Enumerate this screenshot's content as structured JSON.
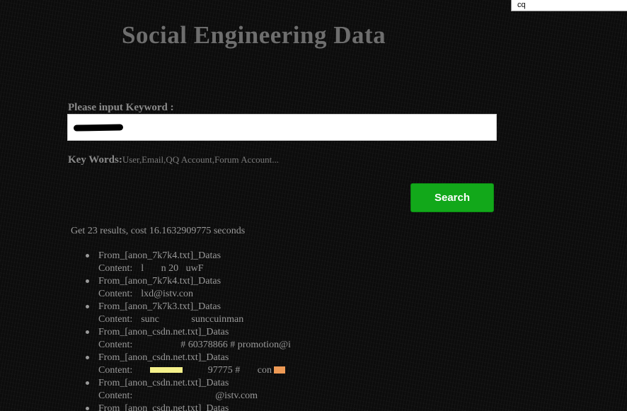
{
  "corner_search": {
    "value": "cq"
  },
  "page": {
    "title": "Social Engineering Data"
  },
  "search": {
    "label": "Please input Keyword :",
    "keywords_heading": "Key Words:",
    "keywords_hint": "User,Email,QQ Account,Forum Account...",
    "button_label": "Search"
  },
  "results": {
    "summary": "Get 23 results, cost 16.1632909775 seconds",
    "content_label": "Content:",
    "items": [
      {
        "from": "From_[anon_7k7k4.txt]_Datas",
        "content": "l       n 20   uwF   "
      },
      {
        "from": "From_[anon_7k7k4.txt]_Datas",
        "content": "lxd@istv.con"
      },
      {
        "from": "From_[anon_7k7k3.txt]_Datas",
        "content": "sunc             sunccuinman"
      },
      {
        "from": "From_[anon_csdn.net.txt]_Datas",
        "content": "                # 60378866 # promotion@i       "
      },
      {
        "from": "From_[anon_csdn.net.txt]_Datas",
        "content": "                           97775 #       con"
      },
      {
        "from": "From_[anon_csdn.net.txt]_Datas",
        "content": "                              @istv.com"
      },
      {
        "from": "From_[anon_csdn.net.txt]_Datas",
        "content": ""
      }
    ]
  },
  "colors": {
    "background": "#0c0c0c",
    "title": "#6e6e6e",
    "button": "#12a81a",
    "text": "#9a9a9a"
  }
}
